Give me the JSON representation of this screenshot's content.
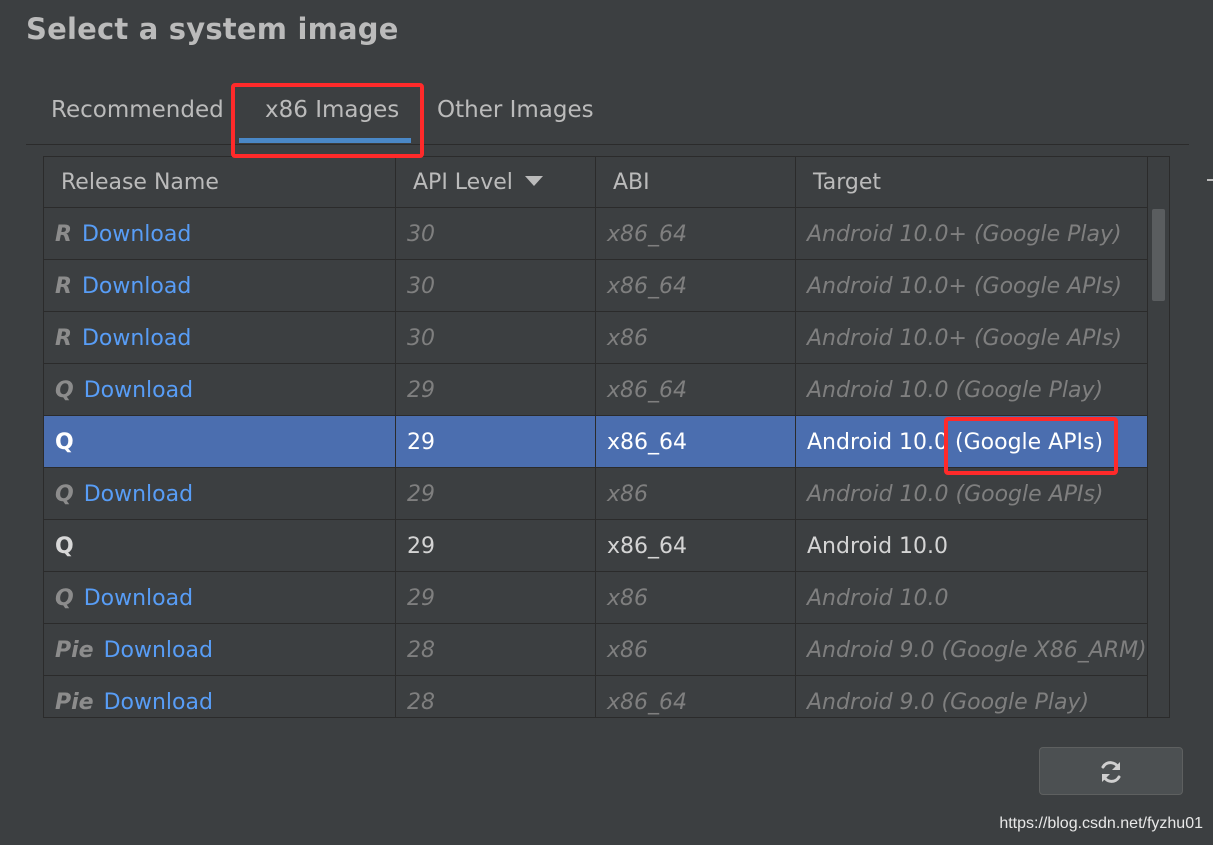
{
  "page": {
    "title": "Select a system image"
  },
  "tabs": [
    {
      "label": "Recommended",
      "active": false
    },
    {
      "label": "x86 Images",
      "active": true
    },
    {
      "label": "Other Images",
      "active": false
    }
  ],
  "table": {
    "columns": [
      "Release Name",
      "API Level",
      "ABI",
      "Target"
    ],
    "sorted_column": "API Level",
    "sort_direction": "descending",
    "rows": [
      {
        "codename": "R",
        "action": "Download",
        "api": "30",
        "abi": "x86_64",
        "target": "Android 10.0+ (Google Play)",
        "state": "not-downloaded"
      },
      {
        "codename": "R",
        "action": "Download",
        "api": "30",
        "abi": "x86_64",
        "target": "Android 10.0+ (Google APIs)",
        "state": "not-downloaded"
      },
      {
        "codename": "R",
        "action": "Download",
        "api": "30",
        "abi": "x86",
        "target": "Android 10.0+ (Google APIs)",
        "state": "not-downloaded"
      },
      {
        "codename": "Q",
        "action": "Download",
        "api": "29",
        "abi": "x86_64",
        "target": "Android 10.0 (Google Play)",
        "state": "not-downloaded"
      },
      {
        "codename": "Q",
        "action": "",
        "api": "29",
        "abi": "x86_64",
        "target": "Android 10.0 (Google APIs)",
        "state": "selected"
      },
      {
        "codename": "Q",
        "action": "Download",
        "api": "29",
        "abi": "x86",
        "target": "Android 10.0 (Google APIs)",
        "state": "not-downloaded"
      },
      {
        "codename": "Q",
        "action": "",
        "api": "29",
        "abi": "x86_64",
        "target": "Android 10.0",
        "state": "downloaded"
      },
      {
        "codename": "Q",
        "action": "Download",
        "api": "29",
        "abi": "x86",
        "target": "Android 10.0",
        "state": "not-downloaded"
      },
      {
        "codename": "Pie",
        "action": "Download",
        "api": "28",
        "abi": "x86",
        "target": "Android 9.0 (Google X86_ARM)",
        "state": "not-downloaded"
      },
      {
        "codename": "Pie",
        "action": "Download",
        "api": "28",
        "abi": "x86_64",
        "target": "Android 9.0 (Google Play)",
        "state": "not-downloaded"
      }
    ]
  },
  "refresh_button": {
    "icon": "refresh-icon"
  },
  "annotations": {
    "color": "#ff2a2a"
  },
  "watermark": "https://blog.csdn.net/fyzhu01",
  "colors": {
    "background": "#3c3f41",
    "link": "#589df6",
    "selection": "#4b6eaf",
    "tab_underline": "#4a88c7"
  }
}
